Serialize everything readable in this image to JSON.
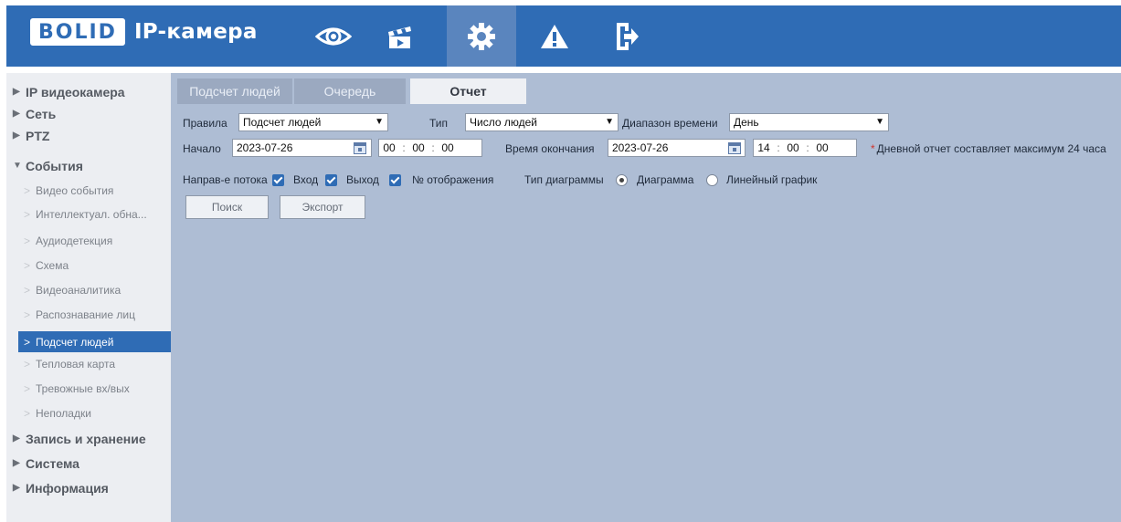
{
  "header": {
    "logo_text": "BOLID",
    "product": "IP-камера",
    "nav": [
      {
        "icon": "eye-icon"
      },
      {
        "icon": "clapperboard-icon"
      },
      {
        "icon": "gear-icon",
        "active": true
      },
      {
        "icon": "warning-icon"
      },
      {
        "icon": "logout-icon"
      }
    ]
  },
  "sidebar": {
    "top": [
      {
        "label": "IP видеокамера",
        "expanded": false
      },
      {
        "label": "Сеть",
        "expanded": false
      },
      {
        "label": "PTZ",
        "expanded": false
      },
      {
        "label": "События",
        "expanded": true
      },
      {
        "label": "Запись и хранение",
        "expanded": false
      },
      {
        "label": "Система",
        "expanded": false
      },
      {
        "label": "Информация",
        "expanded": false
      }
    ],
    "events_sub": [
      {
        "label": "Видео события"
      },
      {
        "label": "Интеллектуал. обна..."
      },
      {
        "label": "Аудиодетекция"
      },
      {
        "label": "Схема"
      },
      {
        "label": "Видеоаналитика"
      },
      {
        "label": "Распознавание лиц"
      },
      {
        "label": "Подсчет людей",
        "active": true
      },
      {
        "label": "Тепловая карта"
      },
      {
        "label": "Тревожные вх/вых"
      },
      {
        "label": "Неполадки"
      }
    ]
  },
  "tabs": [
    {
      "label": "Подсчет людей"
    },
    {
      "label": "Очередь"
    },
    {
      "label": "Отчет",
      "active": true
    }
  ],
  "form": {
    "rules_label": "Правила",
    "rules_value": "Подсчет людей",
    "type_label": "Тип",
    "type_value": "Число людей",
    "range_label": "Диапазон времени",
    "range_value": "День",
    "start_label": "Начало",
    "start_date": "2023-07-26",
    "start_time": {
      "h": "00",
      "m": "00",
      "s": "00"
    },
    "end_label": "Время окончания",
    "end_date": "2023-07-26",
    "end_time": {
      "h": "14",
      "m": "00",
      "s": "00"
    },
    "note_star": "*",
    "note": "Дневной отчет составляет максимум 24 часа",
    "flow_label": "Направ-е потока",
    "in_label": "Вход",
    "out_label": "Выход",
    "display_label": "№ отображения",
    "chart_type_label": "Тип диаграммы",
    "chart_opt1": "Диаграмма",
    "chart_opt2": "Линейный график",
    "time_colon": ":"
  },
  "buttons": {
    "search": "Поиск",
    "export": "Экспорт"
  },
  "colors": {
    "header": "#2f6cb5",
    "sidebar_bg": "#eceef2",
    "main_bg": "#aebdd4",
    "active": "#2f6cb5"
  }
}
